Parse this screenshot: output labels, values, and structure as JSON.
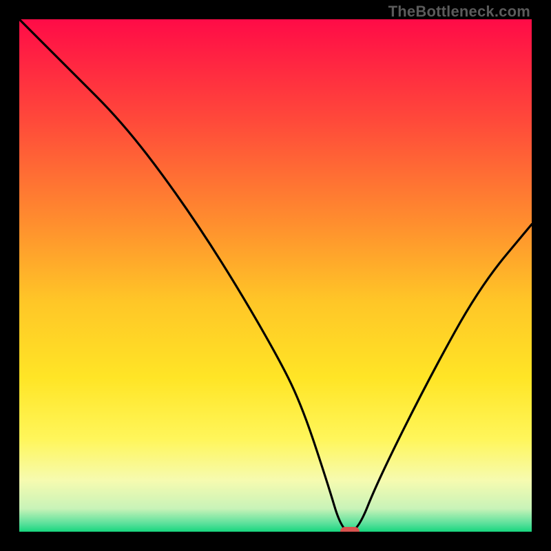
{
  "watermark": "TheBottleneck.com",
  "chart_data": {
    "type": "line",
    "title": "",
    "xlabel": "",
    "ylabel": "",
    "xlim": [
      0,
      100
    ],
    "ylim": [
      0,
      100
    ],
    "grid": false,
    "legend": false,
    "series": [
      {
        "name": "bottleneck-curve",
        "x": [
          0,
          10,
          20,
          30,
          40,
          50,
          55,
          60,
          63,
          66,
          70,
          80,
          90,
          100
        ],
        "y": [
          100,
          90,
          80,
          67,
          52,
          35,
          25,
          10,
          0,
          0,
          10,
          30,
          48,
          60
        ]
      }
    ],
    "marker": {
      "name": "optimal-point",
      "x": 64.5,
      "y": 0,
      "color": "#d9534f"
    },
    "background_gradient": {
      "type": "vertical",
      "stops": [
        {
          "pos": 0.0,
          "color": "#ff0b47"
        },
        {
          "pos": 0.2,
          "color": "#ff4a3a"
        },
        {
          "pos": 0.4,
          "color": "#ff8f2e"
        },
        {
          "pos": 0.55,
          "color": "#ffc627"
        },
        {
          "pos": 0.7,
          "color": "#ffe526"
        },
        {
          "pos": 0.82,
          "color": "#fff65b"
        },
        {
          "pos": 0.9,
          "color": "#f6fbb0"
        },
        {
          "pos": 0.955,
          "color": "#c8f3b8"
        },
        {
          "pos": 0.985,
          "color": "#57e09a"
        },
        {
          "pos": 1.0,
          "color": "#17d67e"
        }
      ]
    }
  }
}
